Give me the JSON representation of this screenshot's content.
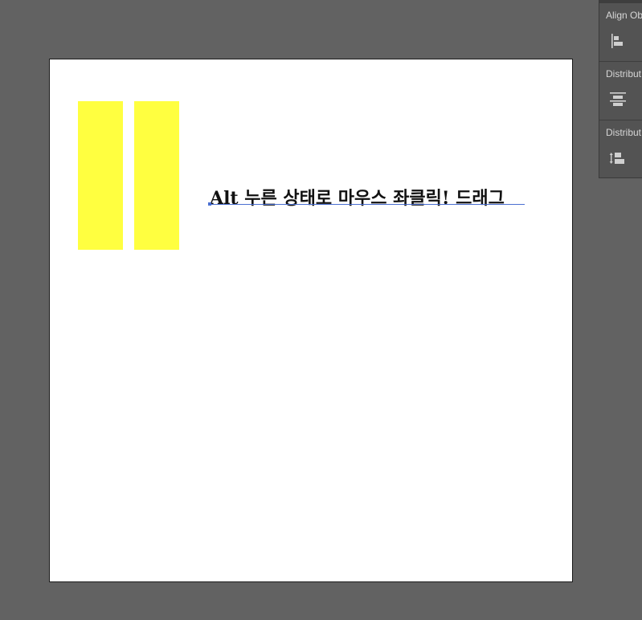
{
  "artboard": {
    "text_object": "Alt 누른 상태로 마우스 좌클릭! 드래그",
    "rect_color": "#ffff40"
  },
  "align_panel": {
    "sections": [
      {
        "label": "Align Ob",
        "icon": "align-left-icon"
      },
      {
        "label": "Distribut",
        "icon": "distribute-vertical-center-icon"
      },
      {
        "label": "Distribut",
        "icon": "distribute-spacing-icon"
      }
    ]
  }
}
